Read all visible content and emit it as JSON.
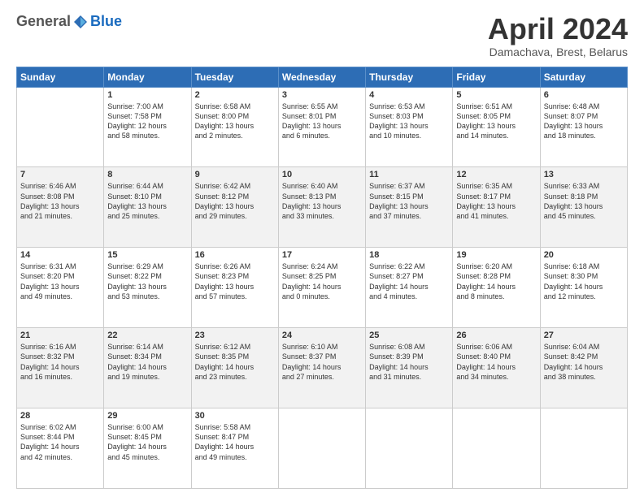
{
  "header": {
    "logo_general": "General",
    "logo_blue": "Blue",
    "month_title": "April 2024",
    "location": "Damachava, Brest, Belarus"
  },
  "weekdays": [
    "Sunday",
    "Monday",
    "Tuesday",
    "Wednesday",
    "Thursday",
    "Friday",
    "Saturday"
  ],
  "weeks": [
    [
      {
        "day": "",
        "text": ""
      },
      {
        "day": "1",
        "text": "Sunrise: 7:00 AM\nSunset: 7:58 PM\nDaylight: 12 hours\nand 58 minutes."
      },
      {
        "day": "2",
        "text": "Sunrise: 6:58 AM\nSunset: 8:00 PM\nDaylight: 13 hours\nand 2 minutes."
      },
      {
        "day": "3",
        "text": "Sunrise: 6:55 AM\nSunset: 8:01 PM\nDaylight: 13 hours\nand 6 minutes."
      },
      {
        "day": "4",
        "text": "Sunrise: 6:53 AM\nSunset: 8:03 PM\nDaylight: 13 hours\nand 10 minutes."
      },
      {
        "day": "5",
        "text": "Sunrise: 6:51 AM\nSunset: 8:05 PM\nDaylight: 13 hours\nand 14 minutes."
      },
      {
        "day": "6",
        "text": "Sunrise: 6:48 AM\nSunset: 8:07 PM\nDaylight: 13 hours\nand 18 minutes."
      }
    ],
    [
      {
        "day": "7",
        "text": "Sunrise: 6:46 AM\nSunset: 8:08 PM\nDaylight: 13 hours\nand 21 minutes."
      },
      {
        "day": "8",
        "text": "Sunrise: 6:44 AM\nSunset: 8:10 PM\nDaylight: 13 hours\nand 25 minutes."
      },
      {
        "day": "9",
        "text": "Sunrise: 6:42 AM\nSunset: 8:12 PM\nDaylight: 13 hours\nand 29 minutes."
      },
      {
        "day": "10",
        "text": "Sunrise: 6:40 AM\nSunset: 8:13 PM\nDaylight: 13 hours\nand 33 minutes."
      },
      {
        "day": "11",
        "text": "Sunrise: 6:37 AM\nSunset: 8:15 PM\nDaylight: 13 hours\nand 37 minutes."
      },
      {
        "day": "12",
        "text": "Sunrise: 6:35 AM\nSunset: 8:17 PM\nDaylight: 13 hours\nand 41 minutes."
      },
      {
        "day": "13",
        "text": "Sunrise: 6:33 AM\nSunset: 8:18 PM\nDaylight: 13 hours\nand 45 minutes."
      }
    ],
    [
      {
        "day": "14",
        "text": "Sunrise: 6:31 AM\nSunset: 8:20 PM\nDaylight: 13 hours\nand 49 minutes."
      },
      {
        "day": "15",
        "text": "Sunrise: 6:29 AM\nSunset: 8:22 PM\nDaylight: 13 hours\nand 53 minutes."
      },
      {
        "day": "16",
        "text": "Sunrise: 6:26 AM\nSunset: 8:23 PM\nDaylight: 13 hours\nand 57 minutes."
      },
      {
        "day": "17",
        "text": "Sunrise: 6:24 AM\nSunset: 8:25 PM\nDaylight: 14 hours\nand 0 minutes."
      },
      {
        "day": "18",
        "text": "Sunrise: 6:22 AM\nSunset: 8:27 PM\nDaylight: 14 hours\nand 4 minutes."
      },
      {
        "day": "19",
        "text": "Sunrise: 6:20 AM\nSunset: 8:28 PM\nDaylight: 14 hours\nand 8 minutes."
      },
      {
        "day": "20",
        "text": "Sunrise: 6:18 AM\nSunset: 8:30 PM\nDaylight: 14 hours\nand 12 minutes."
      }
    ],
    [
      {
        "day": "21",
        "text": "Sunrise: 6:16 AM\nSunset: 8:32 PM\nDaylight: 14 hours\nand 16 minutes."
      },
      {
        "day": "22",
        "text": "Sunrise: 6:14 AM\nSunset: 8:34 PM\nDaylight: 14 hours\nand 19 minutes."
      },
      {
        "day": "23",
        "text": "Sunrise: 6:12 AM\nSunset: 8:35 PM\nDaylight: 14 hours\nand 23 minutes."
      },
      {
        "day": "24",
        "text": "Sunrise: 6:10 AM\nSunset: 8:37 PM\nDaylight: 14 hours\nand 27 minutes."
      },
      {
        "day": "25",
        "text": "Sunrise: 6:08 AM\nSunset: 8:39 PM\nDaylight: 14 hours\nand 31 minutes."
      },
      {
        "day": "26",
        "text": "Sunrise: 6:06 AM\nSunset: 8:40 PM\nDaylight: 14 hours\nand 34 minutes."
      },
      {
        "day": "27",
        "text": "Sunrise: 6:04 AM\nSunset: 8:42 PM\nDaylight: 14 hours\nand 38 minutes."
      }
    ],
    [
      {
        "day": "28",
        "text": "Sunrise: 6:02 AM\nSunset: 8:44 PM\nDaylight: 14 hours\nand 42 minutes."
      },
      {
        "day": "29",
        "text": "Sunrise: 6:00 AM\nSunset: 8:45 PM\nDaylight: 14 hours\nand 45 minutes."
      },
      {
        "day": "30",
        "text": "Sunrise: 5:58 AM\nSunset: 8:47 PM\nDaylight: 14 hours\nand 49 minutes."
      },
      {
        "day": "",
        "text": ""
      },
      {
        "day": "",
        "text": ""
      },
      {
        "day": "",
        "text": ""
      },
      {
        "day": "",
        "text": ""
      }
    ]
  ]
}
